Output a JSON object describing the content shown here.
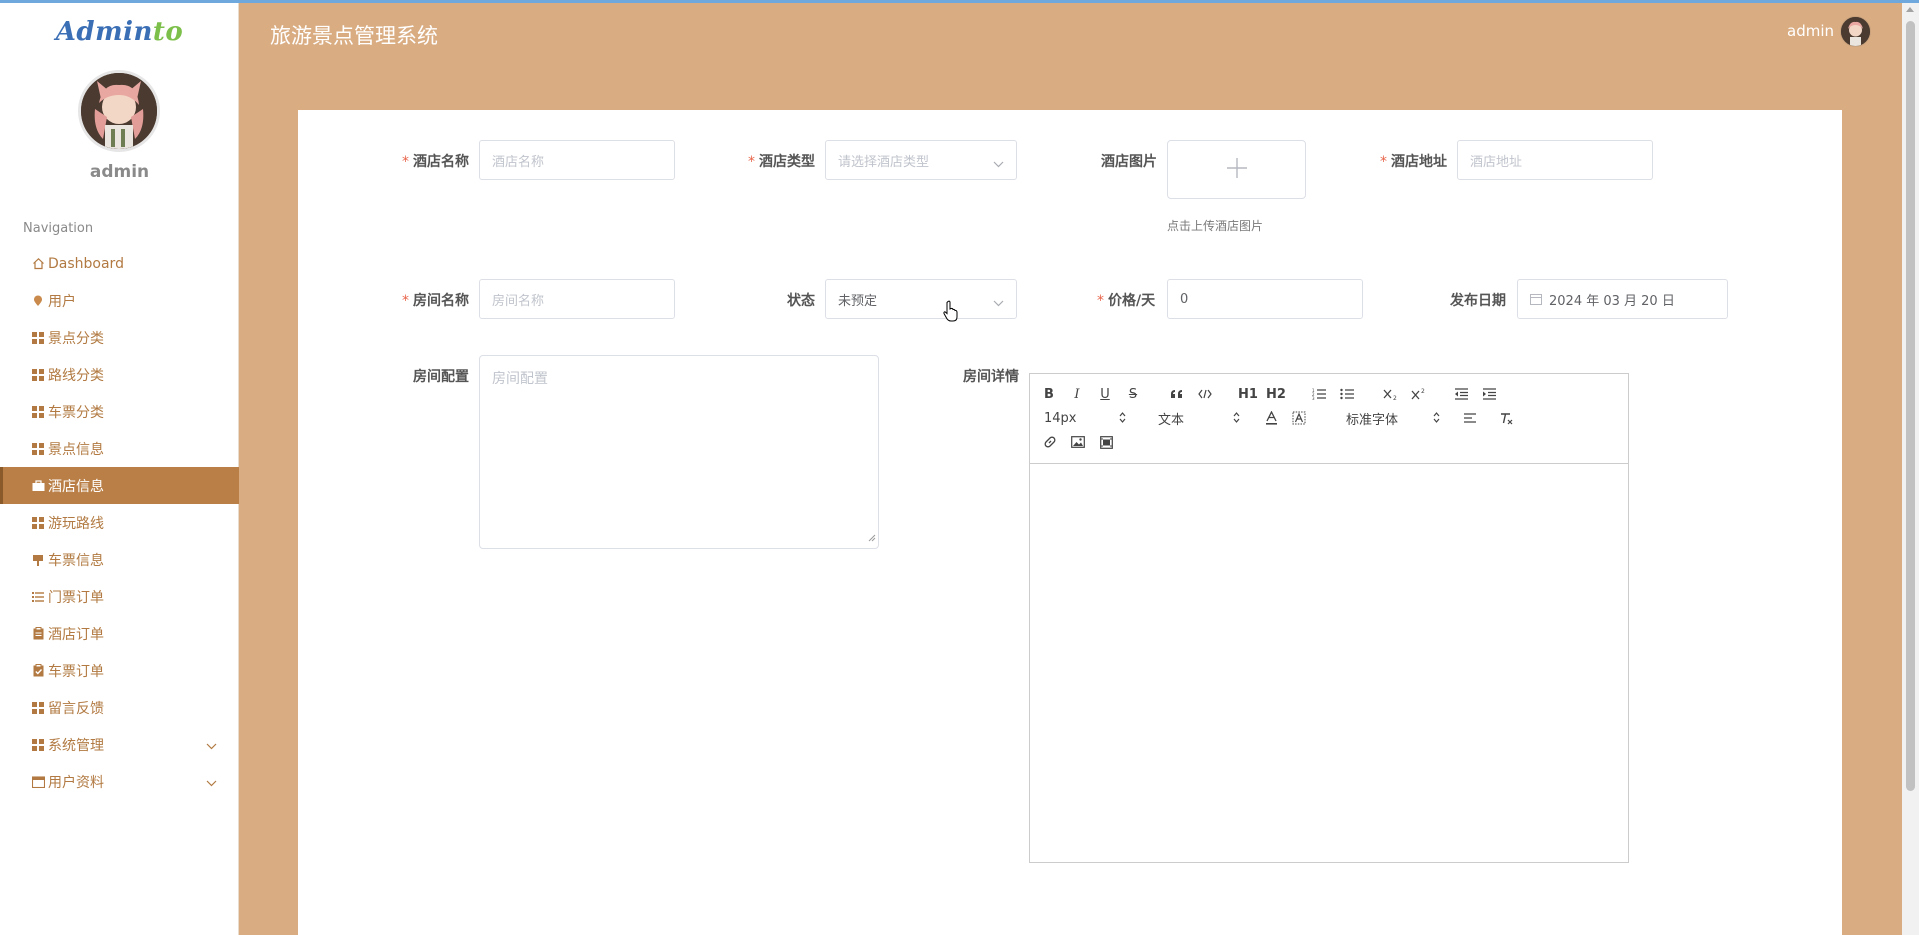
{
  "app": {
    "title": "旅游景点管理系统",
    "user": "admin"
  },
  "brand": {
    "logo_main": "Admin",
    "logo_accent": "to",
    "accent_color": "#b97f46",
    "header_bg": "#d9ac82"
  },
  "sidebar": {
    "username": "admin",
    "nav_title": "Navigation",
    "items": [
      {
        "label": "Dashboard",
        "icon": "home-icon"
      },
      {
        "label": "用户",
        "icon": "map-pin-icon"
      },
      {
        "label": "景点分类",
        "icon": "grid-icon"
      },
      {
        "label": "路线分类",
        "icon": "grid-icon"
      },
      {
        "label": "车票分类",
        "icon": "grid-icon"
      },
      {
        "label": "景点信息",
        "icon": "grid-icon"
      },
      {
        "label": "酒店信息",
        "icon": "briefcase-icon",
        "active": true
      },
      {
        "label": "游玩路线",
        "icon": "grid-icon"
      },
      {
        "label": "车票信息",
        "icon": "flag-icon"
      },
      {
        "label": "门票订单",
        "icon": "list-icon"
      },
      {
        "label": "酒店订单",
        "icon": "clipboard-icon"
      },
      {
        "label": "车票订单",
        "icon": "clipboard-check-icon"
      },
      {
        "label": "留言反馈",
        "icon": "grid-icon"
      },
      {
        "label": "系统管理",
        "icon": "grid-icon",
        "expandable": true
      },
      {
        "label": "用户资料",
        "icon": "calendar-icon",
        "expandable": true
      }
    ]
  },
  "form": {
    "hotel_name": {
      "label": "酒店名称",
      "placeholder": "酒店名称",
      "required": true
    },
    "hotel_type": {
      "label": "酒店类型",
      "placeholder": "请选择酒店类型",
      "required": true
    },
    "hotel_image": {
      "label": "酒店图片",
      "hint": "点击上传酒店图片"
    },
    "hotel_address": {
      "label": "酒店地址",
      "placeholder": "酒店地址",
      "required": true
    },
    "room_name": {
      "label": "房间名称",
      "placeholder": "房间名称",
      "required": true
    },
    "status": {
      "label": "状态",
      "value": "未预定"
    },
    "price": {
      "label": "价格/天",
      "value": "0",
      "required": true
    },
    "publish_date": {
      "label": "发布日期",
      "value": "2024 年 03 月 20 日"
    },
    "room_config": {
      "label": "房间配置",
      "placeholder": "房间配置"
    },
    "room_detail": {
      "label": "房间详情"
    }
  },
  "editor": {
    "bold": "B",
    "italic": "I",
    "underline": "U",
    "strike": "S",
    "h1": "H1",
    "h2": "H2",
    "font_size": "14px",
    "block_type": "文本",
    "font_family": "标准字体"
  }
}
